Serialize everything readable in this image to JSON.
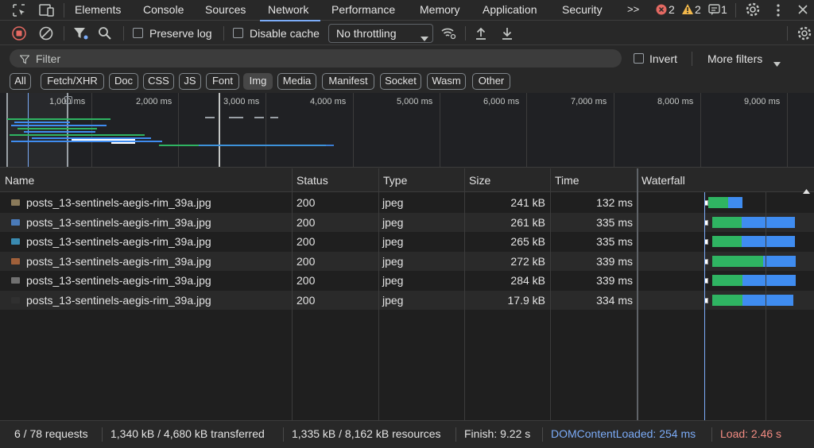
{
  "tabs": [
    {
      "label": "Elements"
    },
    {
      "label": "Console"
    },
    {
      "label": "Sources"
    },
    {
      "label": "Network",
      "active": true
    },
    {
      "label": "Performance"
    },
    {
      "label": "Memory"
    },
    {
      "label": "Application"
    },
    {
      "label": "Security"
    }
  ],
  "more_tabs_glyph": ">>",
  "issues": {
    "errors": "2",
    "warnings": "2",
    "messages": "1"
  },
  "toolbar": {
    "preserve_log_label": "Preserve log",
    "preserve_log_checked": false,
    "disable_cache_label": "Disable cache",
    "disable_cache_checked": false,
    "throttling_value": "No throttling"
  },
  "filter": {
    "placeholder": "Filter",
    "invert_label": "Invert",
    "more_filters_label": "More filters"
  },
  "type_filters": [
    {
      "label": "All",
      "active": false
    },
    {
      "label": "Fetch/XHR",
      "active": false
    },
    {
      "label": "Doc",
      "active": false
    },
    {
      "label": "CSS",
      "active": false
    },
    {
      "label": "JS",
      "active": false
    },
    {
      "label": "Font",
      "active": false
    },
    {
      "label": "Img",
      "active": true
    },
    {
      "label": "Media",
      "active": false
    },
    {
      "label": "Manifest",
      "active": false
    },
    {
      "label": "Socket",
      "active": false
    },
    {
      "label": "Wasm",
      "active": false
    },
    {
      "label": "Other",
      "active": false
    }
  ],
  "overview": {
    "ticks": [
      "1,000 ms",
      "2,000 ms",
      "3,000 ms",
      "4,000 ms",
      "5,000 ms",
      "6,000 ms",
      "7,000 ms",
      "8,000 ms",
      "9,000 ms"
    ]
  },
  "columns": {
    "name": "Name",
    "status": "Status",
    "type": "Type",
    "size": "Size",
    "time": "Time",
    "waterfall": "Waterfall"
  },
  "requests": [
    {
      "name": "posts_13-sentinels-aegis-rim_39a.jpg",
      "status": "200",
      "type": "jpeg",
      "size": "241 kB",
      "time": "132 ms",
      "thumb_color": "#8a7a5a"
    },
    {
      "name": "posts_13-sentinels-aegis-rim_39a.jpg",
      "status": "200",
      "type": "jpeg",
      "size": "261 kB",
      "time": "335 ms",
      "thumb_color": "#4a7ab8"
    },
    {
      "name": "posts_13-sentinels-aegis-rim_39a.jpg",
      "status": "200",
      "type": "jpeg",
      "size": "265 kB",
      "time": "335 ms",
      "thumb_color": "#3a8ab0"
    },
    {
      "name": "posts_13-sentinels-aegis-rim_39a.jpg",
      "status": "200",
      "type": "jpeg",
      "size": "272 kB",
      "time": "339 ms",
      "thumb_color": "#a0603a"
    },
    {
      "name": "posts_13-sentinels-aegis-rim_39a.jpg",
      "status": "200",
      "type": "jpeg",
      "size": "284 kB",
      "time": "339 ms",
      "thumb_color": "#707070"
    },
    {
      "name": "posts_13-sentinels-aegis-rim_39a.jpg",
      "status": "200",
      "type": "jpeg",
      "size": "17.9 kB",
      "time": "334 ms",
      "thumb_color": "#303030"
    }
  ],
  "status_bar": {
    "requests": "6 / 78 requests",
    "transferred": "1,340 kB / 4,680 kB transferred",
    "resources": "1,335 kB / 8,162 kB resources",
    "finish": "Finish: 9.22 s",
    "dom_content_loaded": "DOMContentLoaded: 254 ms",
    "load": "Load: 2.46 s"
  },
  "colors": {
    "dom_content_loaded": "#7cacf8",
    "load": "#f28b82",
    "waterfall_waiting": "#2fb462",
    "waterfall_download": "#3f8cf0"
  }
}
